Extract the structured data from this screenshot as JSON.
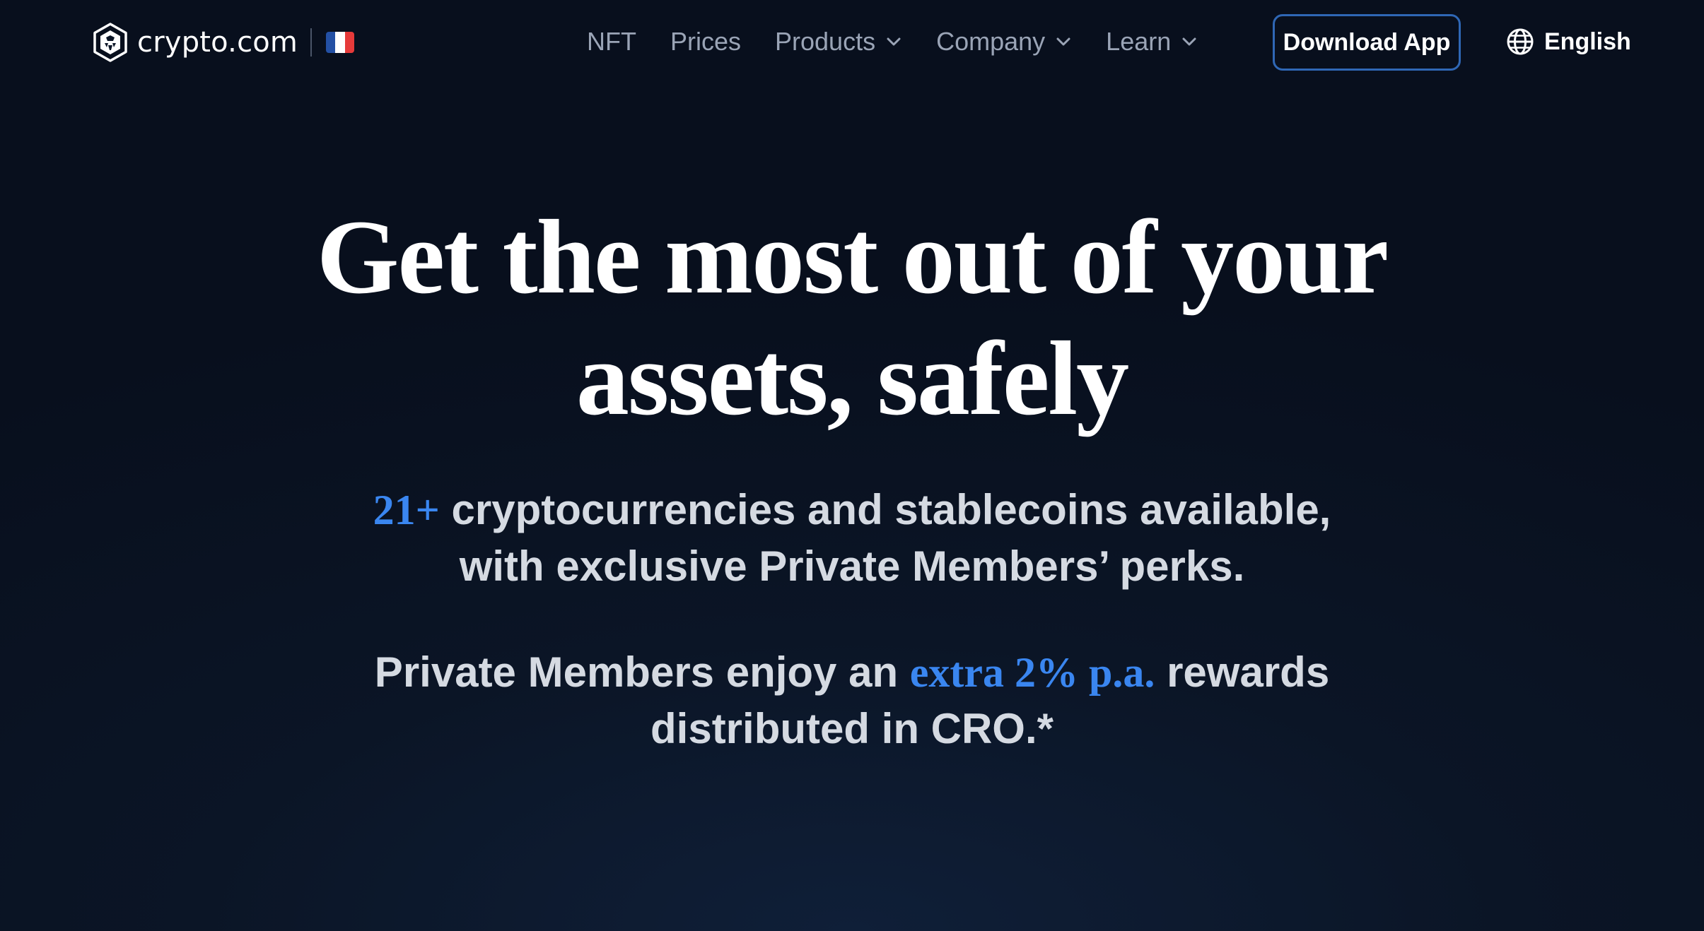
{
  "navbar": {
    "logo": {
      "text": "crypto.com",
      "icon": "crypto-com-lion-shield-icon",
      "flag_icon": "france-flag-icon",
      "flag_colors": [
        "#2350a4",
        "#ffffff",
        "#e63a3a"
      ]
    },
    "links": [
      {
        "label": "NFT",
        "has_dropdown": false
      },
      {
        "label": "Prices",
        "has_dropdown": false
      },
      {
        "label": "Products",
        "has_dropdown": true
      },
      {
        "label": "Company",
        "has_dropdown": true
      },
      {
        "label": "Learn",
        "has_dropdown": true
      }
    ],
    "download_button": "Download App",
    "language": {
      "label": "English",
      "icon": "globe-icon"
    }
  },
  "hero": {
    "title_line1": "Get the most out of your",
    "title_line2": "assets, safely",
    "subtitle1": {
      "highlight": "21+",
      "line1_rest": " cryptocurrencies and stablecoins available,",
      "line2": "with exclusive Private Members’ perks."
    },
    "subtitle2": {
      "prefix": "Private Members enjoy an ",
      "highlight": "extra 2% p.a.",
      "suffix": " rewards",
      "line2": "distributed in CRO.*"
    }
  },
  "colors": {
    "background": "#0a1322",
    "accent_blue": "#3a86f0",
    "nav_text": "#9aa4b6",
    "button_border": "#2f67b5",
    "body_text": "#d5dae2"
  }
}
